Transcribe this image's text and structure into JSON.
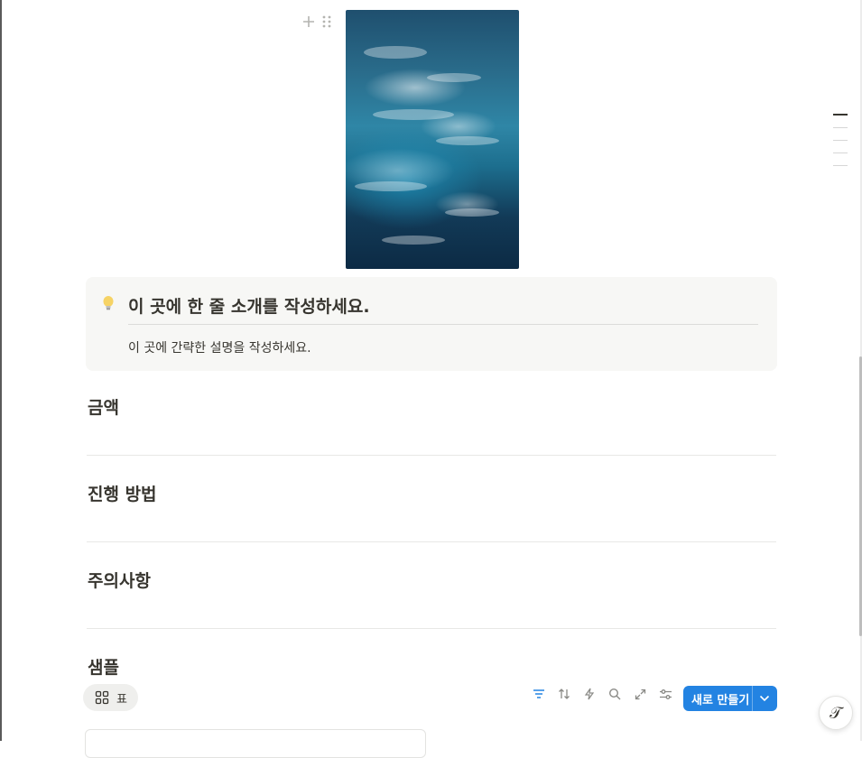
{
  "icons": {
    "add_block": "plus-icon",
    "drag_handle": "drag-icon",
    "callout_emoji": "lightbulb-icon",
    "view_tab": "grid-icon",
    "help": "help-icon"
  },
  "callout": {
    "title": "이 곳에 한 줄 소개를 작성하세요.",
    "body": "이 곳에 간략한 설명을 작성하세요."
  },
  "sections": [
    {
      "title": "금액"
    },
    {
      "title": "진행 방법"
    },
    {
      "title": "주의사항"
    },
    {
      "title": "샘플"
    }
  ],
  "database": {
    "view_tab_label": "표",
    "toolbar": [
      "filter-icon",
      "sort-icon",
      "automation-icon",
      "search-icon",
      "expand-icon",
      "settings-icon"
    ],
    "new_button_label": "새로 만들기"
  },
  "help_button": "𝒯",
  "colors": {
    "accent": "#2383e2",
    "filter_active": "#2383e2",
    "callout_bg": "#f7f7f5"
  }
}
